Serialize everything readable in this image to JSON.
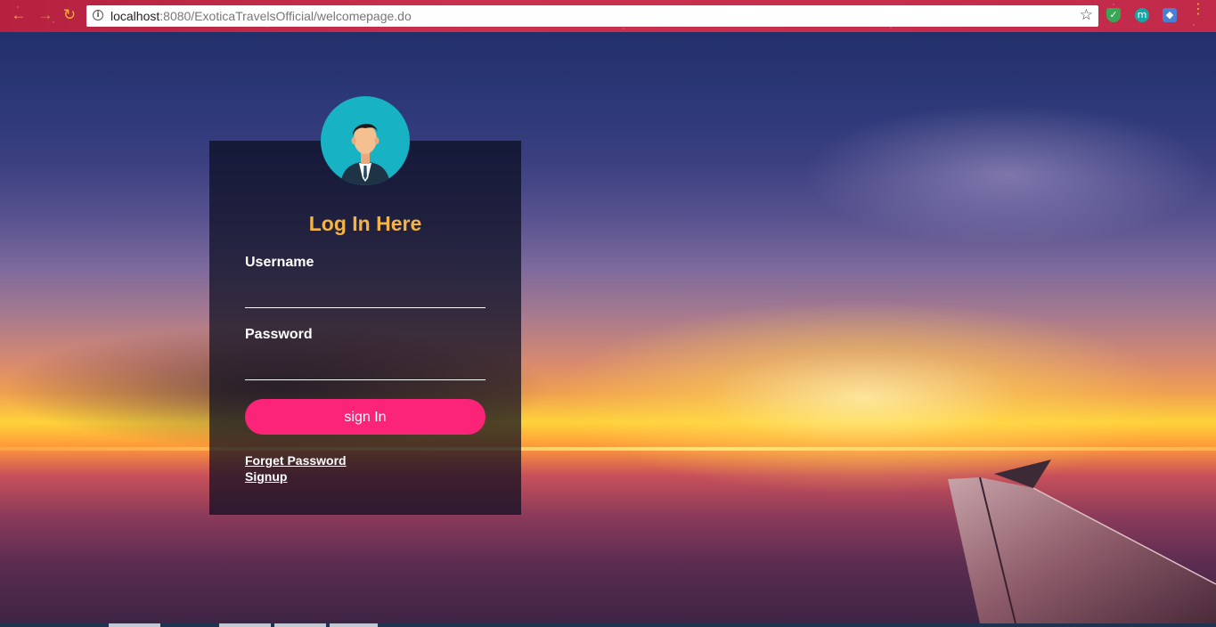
{
  "browser": {
    "url_host": "localhost",
    "url_rest": ":8080/ExoticaTravelsOfficial/welcomepage.do",
    "back_icon": "arrow-left-icon",
    "forward_icon": "arrow-right-icon",
    "reload_icon": "reload-icon",
    "info_icon": "info-icon",
    "info_glyph": "i",
    "bookmark_icon": "star-icon",
    "extensions": [
      {
        "name": "shield-extension-icon",
        "glyph": "✓",
        "color": "#3aa757"
      },
      {
        "name": "m-extension-icon",
        "glyph": "m",
        "color": "#16a6a6"
      },
      {
        "name": "cube-extension-icon",
        "glyph": "◆",
        "color": "#4a7fd4"
      }
    ]
  },
  "login": {
    "title": "Log In Here",
    "username_label": "Username",
    "username_value": "",
    "password_label": "Password",
    "password_value": "",
    "signin_label": "sign In",
    "forgot_label": "Forget Password",
    "signup_label": "Signup",
    "avatar_icon": "user-avatar-icon"
  },
  "colors": {
    "title": "#f5b342",
    "button": "#fb2479",
    "avatar_bg": "#17b2c4",
    "chrome": "#c22a49"
  }
}
